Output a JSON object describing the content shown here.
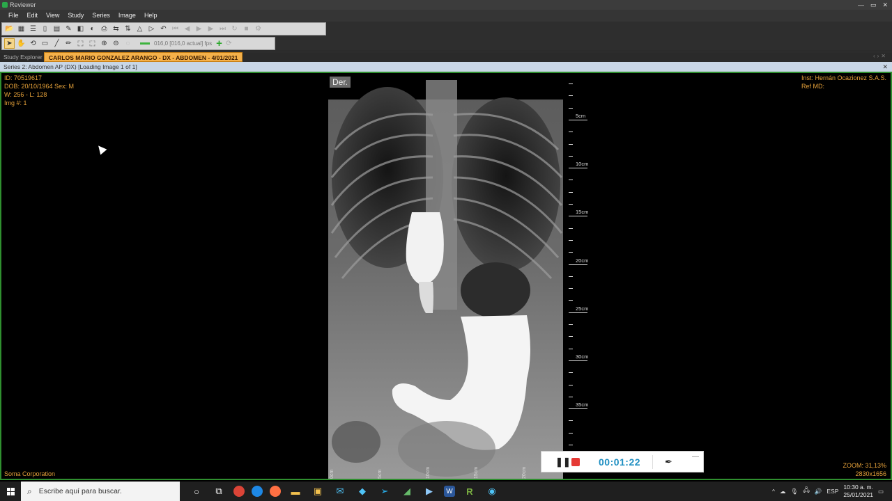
{
  "window": {
    "title": "Reviewer",
    "controls": [
      "—",
      "▭",
      "✕"
    ]
  },
  "menu": {
    "items": [
      "File",
      "Edit",
      "View",
      "Study",
      "Series",
      "Image",
      "Help"
    ]
  },
  "toolbar": {
    "fps_text": "016,0 [016,0 actual] fps"
  },
  "tabs": {
    "explorer": "Study Explorer",
    "active": "CARLOS MARIO GONZALEZ ARANGO - DX - ABDOMEN - 4/01/2021"
  },
  "series_bar": {
    "text": "Series 2: Abdomen AP (DX) [Loading Image 1 of 1]",
    "close": "✕"
  },
  "overlay": {
    "top_left": [
      "ID: 70519617",
      "DOB: 20/10/1964 Sex: M",
      "W: 256 - L: 128",
      "Img #: 1"
    ],
    "top_right": [
      "Inst: Hernán Ocazionez S.A.S.",
      "Ref MD:"
    ],
    "bottom_left": "Soma Corporation",
    "bottom_right": [
      "ZOOM: 31,13%",
      "2830x1656"
    ],
    "orientation": "Der."
  },
  "ruler": {
    "vertical_labels": [
      "5cm",
      "10cm",
      "15cm",
      "20cm",
      "25cm",
      "30cm",
      "35cm"
    ],
    "horizontal_labels": [
      "0cm",
      "5cm",
      "10cm",
      "15cm",
      "20cm"
    ]
  },
  "recorder": {
    "time": "00:01:22"
  },
  "taskbar": {
    "search_placeholder": "Escribe aquí para buscar.",
    "lang": "ESP",
    "time": "10:30 a. m.",
    "date": "25/01/2021"
  }
}
